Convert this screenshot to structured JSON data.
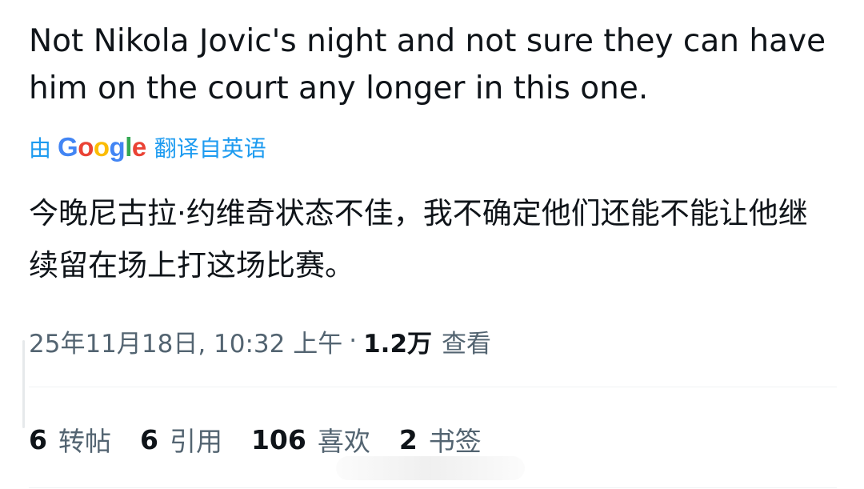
{
  "tweet": {
    "original_text": "Not Nikola Jovic's night and not sure they can have him on the court any longer in this one.",
    "translation": {
      "by_label": "由",
      "google_letters": [
        "G",
        "o",
        "o",
        "g",
        "l",
        "e"
      ],
      "source_label": "翻译自英语"
    },
    "translated_text": "今晚尼古拉·约维奇状态不佳，我不确定他们还能不能让他继续留在场上打这场比赛。",
    "meta": {
      "timestamp": "25年11月18日, 10:32 上午",
      "separator": "·",
      "views_count": "1.2万",
      "views_label": "查看"
    },
    "stats": [
      {
        "count": "6",
        "label": "转帖"
      },
      {
        "count": "6",
        "label": "引用"
      },
      {
        "count": "106",
        "label": "喜欢"
      },
      {
        "count": "2",
        "label": "书签"
      }
    ]
  },
  "colors": {
    "text_primary": "#0f1419",
    "text_secondary": "#536471",
    "link_blue": "#1d9bf0",
    "divider": "#eff3f4"
  }
}
